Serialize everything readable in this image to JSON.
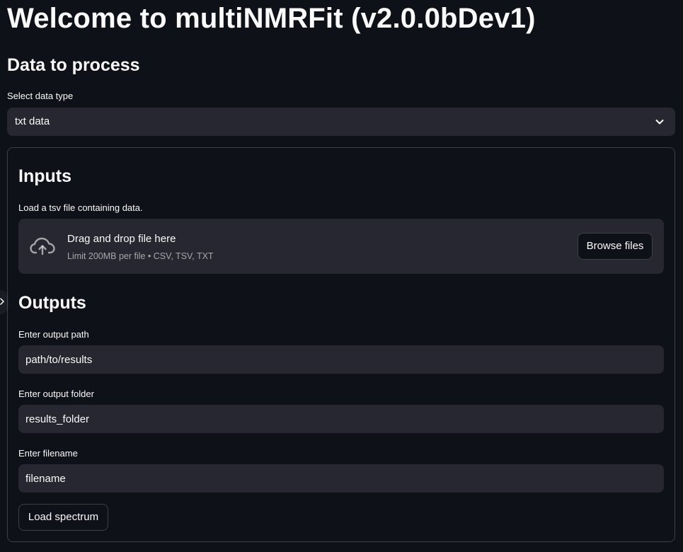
{
  "header": {
    "title": "Welcome to multiNMRFit (v2.0.0bDev1)"
  },
  "data_section": {
    "title": "Data to process",
    "select_label": "Select data type",
    "select_value": "txt data",
    "select_icon": "chevron-down-icon"
  },
  "inputs": {
    "title": "Inputs",
    "uploader_label": "Load a tsv file containing data.",
    "drop_title": "Drag and drop file here",
    "drop_limit": "Limit 200MB per file • CSV, TSV, TXT",
    "upload_icon": "cloud-upload-icon",
    "browse_label": "Browse files"
  },
  "outputs": {
    "title": "Outputs",
    "fields": [
      {
        "label": "Enter output path",
        "value": "path/to/results"
      },
      {
        "label": "Enter output folder",
        "value": "results_folder"
      },
      {
        "label": "Enter filename",
        "value": "filename"
      }
    ],
    "load_label": "Load spectrum"
  },
  "colors": {
    "background": "#0e1117",
    "widget": "#262730",
    "text": "#fafafa"
  }
}
